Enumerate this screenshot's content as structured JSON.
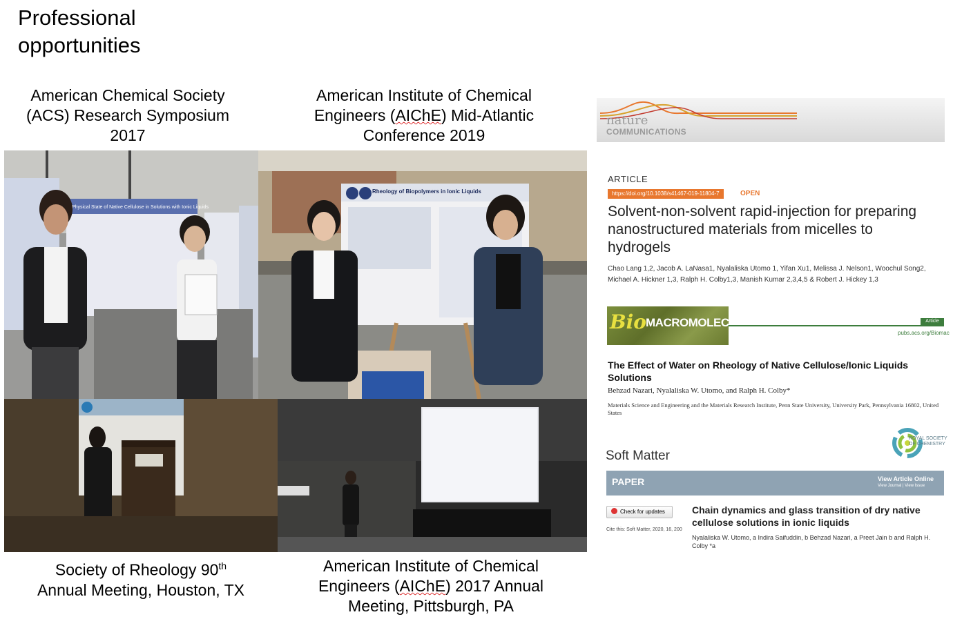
{
  "heading": {
    "line1": "Professional",
    "line2": "opportunities"
  },
  "captions": {
    "acs": [
      "American Chemical Society",
      "(ACS) Research Symposium",
      "2017"
    ],
    "aiche_mid": {
      "l1": "American Institute of Chemical",
      "l2a": "Engineers (",
      "l2b": "AIChE",
      "l2c": ") Mid-Atlantic",
      "l3": "Conference 2019"
    },
    "sor": {
      "l1a": "Society of Rheology 90",
      "l1sup": "th",
      "l2": "Annual Meeting, Houston, TX"
    },
    "aiche_annual": {
      "l1": "American Institute of Chemical",
      "l2a": "Engineers (",
      "l2b": "AIChE",
      "l2c": ") 2017 Annual",
      "l3": "Meeting, Pittsburgh, PA"
    }
  },
  "poster_text": {
    "acs_poster": "Physical State of Native Cellulose in Solutions with Ionic Liquids",
    "aiche_poster": "Rheology of Biopolymers in Ionic Liquids"
  },
  "nature_comms": {
    "brand1": "nature",
    "brand2": "COMMUNICATIONS",
    "label": "ARTICLE",
    "doi": "https://doi.org/10.1038/s41467-019-11804-7",
    "open": "OPEN",
    "title": "Solvent-non-solvent rapid-injection for preparing nanostructured materials from micelles to hydrogels",
    "authors": "Chao Lang 1,2, Jacob A. LaNasa1, Nyalaliska Utomo 1, Yifan Xu1, Melissa J. Nelson1, Woochul Song2, Michael A. Hickner 1,3, Ralph H. Colby1,3, Manish Kumar 2,3,4,5 & Robert J. Hickey 1,3"
  },
  "biomac": {
    "logo_bio": "Bio",
    "logo_rest": "MACROMOLECULES",
    "tag": "Article",
    "url": "pubs.acs.org/Biomac",
    "title": "The Effect of Water on Rheology of Native Cellulose/Ionic Liquids Solutions",
    "authors": "Behzad Nazari, Nyalaliska W. Utomo, and Ralph H. Colby*",
    "affiliation": "Materials Science and Engineering and the Materials Research Institute, Penn State University, University Park, Pennsylvania 16802, United States"
  },
  "soft_matter": {
    "journal": "Soft Matter",
    "rsc": [
      "ROYAL SOCIETY",
      "OF CHEMISTRY"
    ],
    "section": "PAPER",
    "view_online": "View Article Online",
    "view_links": "View Journal | View Issue",
    "check": "Check for updates",
    "cite": "Cite this: Soft Matter, 2020, 16, 200",
    "title": "Chain dynamics and glass transition of dry native cellulose solutions in ionic liquids",
    "authors": "Nyalaliska W. Utomo, a Indira Saifuddin, b Behzad Nazari, a Preet Jain b and Ralph H. Colby *a"
  },
  "colors": {
    "nature_orange": "#e8772e",
    "acs_green": "#3d7d3d",
    "rsc_bar": "#8fa3b3"
  }
}
